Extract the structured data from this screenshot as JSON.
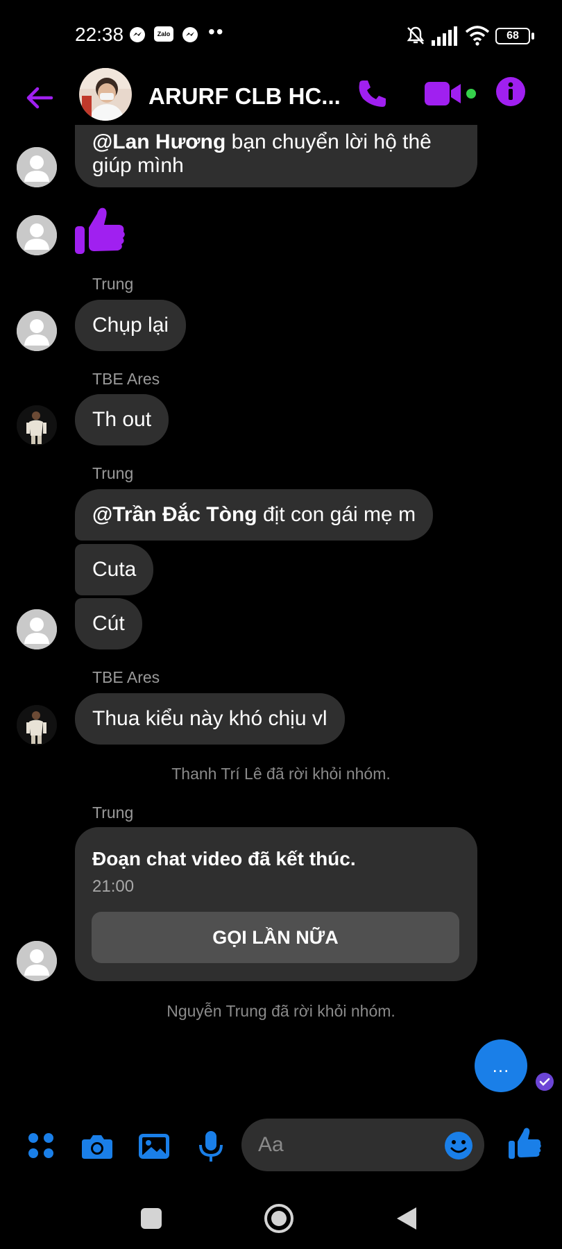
{
  "status_bar": {
    "time": "22:38",
    "app_icons": [
      "messenger-icon",
      "zalo-icon",
      "messenger-icon"
    ],
    "zalo_label": "Zalo",
    "overflow": "••",
    "battery": "68"
  },
  "header": {
    "title": "ARURF CLB HC..."
  },
  "messages": {
    "top_bubble": {
      "line1_mention": "@Lan Hương",
      "line1_text": " bạn chuyển lời hộ thê",
      "line2": "giúp mình"
    },
    "m1_sender": "Trung",
    "m1_text": "Chụp lại",
    "m2_sender": "TBE Ares",
    "m2_text": "Th out",
    "m3_sender": "Trung",
    "m3_mention": "@Trần Đắc Tòng",
    "m3_text": " địt con gái mẹ m",
    "m4_text": "Cuta",
    "m5_text": "Cút",
    "m6_sender": "TBE Ares",
    "m6_text": "Thua kiểu này khó chịu vl",
    "system1": "Thanh Trí Lê đã rời khỏi nhóm.",
    "m7_sender": "Trung",
    "call_card": {
      "title": "Đoạn chat video đã kết thúc.",
      "time": "21:00",
      "button": "GỌI LẦN NỮA"
    },
    "system2": "Nguyễn Trung đã rời khỏi nhóm.",
    "typing": "..."
  },
  "composer": {
    "placeholder": "Aa"
  },
  "colors": {
    "accent_purple": "#a020f0",
    "accent_blue": "#1a7fe8",
    "bubble": "#2f2f2f",
    "background": "#000000"
  }
}
